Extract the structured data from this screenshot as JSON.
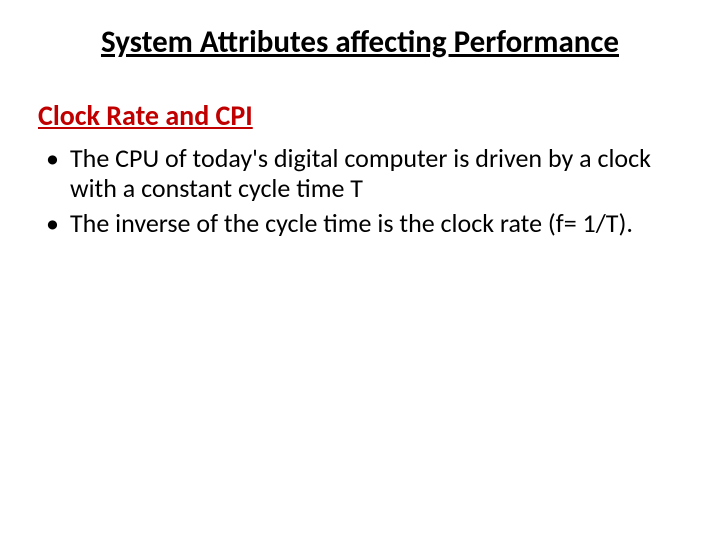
{
  "title": "System Attributes affecting Performance",
  "subheading": "Clock Rate and CPI",
  "bullets": [
    "The CPU of today's digital computer is driven by a clock  with a constant cycle time T",
    "The inverse of the cycle time is the clock rate (f= 1/T)."
  ]
}
